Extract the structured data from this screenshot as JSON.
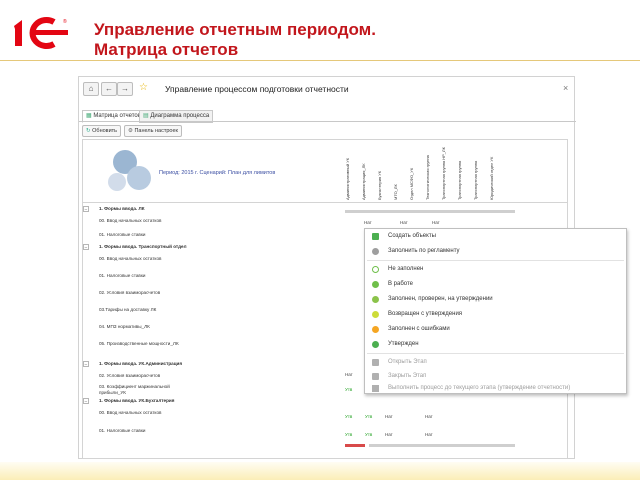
{
  "slide": {
    "title_line1": "Управление отчетным периодом.",
    "title_line2": "Матрица отчетов"
  },
  "window": {
    "title": "Управление процессом подготовки отчетности",
    "close": "×"
  },
  "tabs": [
    {
      "label": "Матрица отчетов"
    },
    {
      "label": "Диаграмма процесса"
    }
  ],
  "toolbar": {
    "refresh": "Обновить",
    "settings": "Панель настроек"
  },
  "period": "Период: 2015 г. Сценарий: План для лимитов",
  "columns": [
    "Административный УК",
    "Администрация_ЛК",
    "Бухгалтерия УК",
    "МТО_ЛК",
    "Отдел МСФО_УК",
    "Технологическая группа НР_ЛК",
    "Транспортная группа НР_ЛК",
    "Транспортная группа ЖКХ_ЛК",
    "Транспортная группа ЖКХ_ЛК",
    "Юридический отдел УК"
  ],
  "rows": [
    {
      "text": "1. Формы ввода. ЛК",
      "bold": true
    },
    {
      "text": "00. Ввод начальных остатков",
      "bold": false
    },
    {
      "text": "01. Налоговые ставки",
      "bold": false
    },
    {
      "text": "1. Формы ввода. Транспортный отдел",
      "bold": true
    },
    {
      "text": "00. Ввод начальных остатков",
      "bold": false
    },
    {
      "text": "01. Налоговые ставки",
      "bold": false
    },
    {
      "text": "02. Условия взаиморасчетов",
      "bold": false
    },
    {
      "text": "03.Тарифы на доставку ЛК",
      "bold": false
    },
    {
      "text": "04. МПЗ нормативы_ЛК",
      "bold": false
    },
    {
      "text": "05. Производственные мощности_ЛК",
      "bold": false
    },
    {
      "text": "1. Формы ввода. УК.Администрация",
      "bold": true
    },
    {
      "text": "02. Условия взаиморасчетов",
      "bold": false
    },
    {
      "text": "03. Коэффициент маржинальной\nприбыли_УК",
      "bold": false
    },
    {
      "text": "1. Формы ввода. УК.Бухгалтерия",
      "bold": true
    },
    {
      "text": "00. Ввод начальных остатков",
      "bold": false
    },
    {
      "text": "01. Налоговые ставки",
      "bold": false
    }
  ],
  "cells": {
    "nat": "Нат",
    "utv": "Утв"
  },
  "menu": [
    {
      "label": "Создать объекты",
      "icon": "create-objects-icon",
      "color": "#4caf50",
      "disabled": false
    },
    {
      "label": "Заполнить по регламенту",
      "icon": "fill-by-schedule-icon",
      "color": "#9e9e9e",
      "disabled": false
    },
    {
      "label": "Не заполнен",
      "icon": "not-filled-icon",
      "color": "#6fbf4a",
      "disabled": false
    },
    {
      "label": "В работе",
      "icon": "in-work-icon",
      "color": "#6fbf4a",
      "disabled": false
    },
    {
      "label": "Заполнен, проверен, на утверждении",
      "icon": "filled-checked-icon",
      "color": "#8bc34a",
      "disabled": false
    },
    {
      "label": "Возвращен с утверждения",
      "icon": "returned-icon",
      "color": "#cddc39",
      "disabled": false
    },
    {
      "label": "Заполнен с ошибками",
      "icon": "filled-with-errors-icon",
      "color": "#f5a623",
      "disabled": false
    },
    {
      "label": "Утвержден",
      "icon": "approved-icon",
      "color": "#4caf50",
      "disabled": false
    },
    {
      "label": "Открыть Этап",
      "icon": "open-stage-icon",
      "color": "#b0b0b0",
      "disabled": true
    },
    {
      "label": "Закрыть Этап",
      "icon": "close-stage-icon",
      "color": "#b0b0b0",
      "disabled": true
    },
    {
      "label": "Выполнить процесс до текущего этапа (утверждение отчетности)",
      "icon": "run-process-icon",
      "color": "#b0b0b0",
      "disabled": true
    }
  ],
  "colors": {
    "title": "#c2161c",
    "accent": "#e5c87a"
  }
}
